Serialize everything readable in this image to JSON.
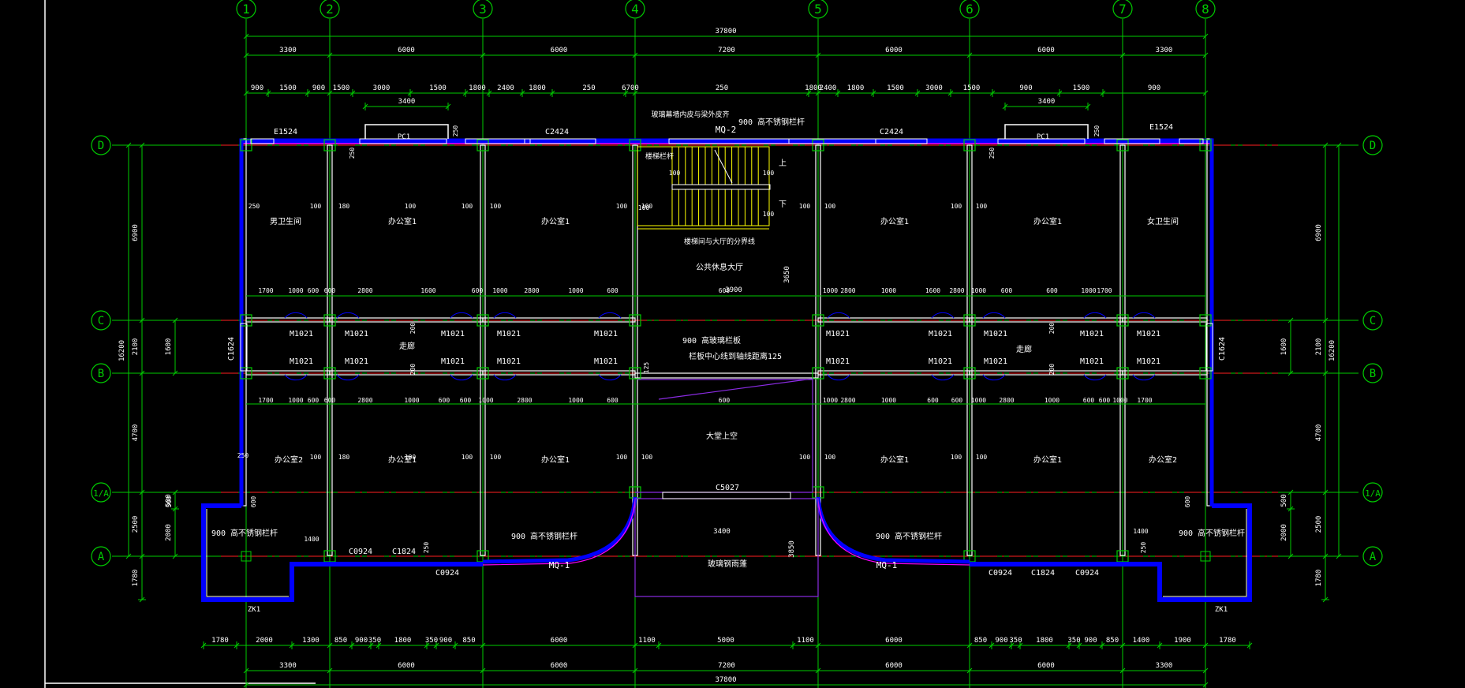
{
  "colors": {
    "background": "#000000",
    "grid_line": "#00cc00",
    "axis_dash": "#ff2020",
    "wall": "#ffffff",
    "wall_fill": "#0000ff",
    "window": "#ff00ff",
    "stair": "#ffff00",
    "text": "#ffffff",
    "dim_text": "#ffffff",
    "opening": "#8a2be2"
  },
  "axes": {
    "vertical": [
      "1",
      "2",
      "3",
      "4",
      "5",
      "6",
      "7",
      "8"
    ],
    "horizontal_left": [
      "D",
      "C",
      "B",
      "1/A",
      "A"
    ],
    "horizontal_right": [
      "D",
      "C",
      "B",
      "1/A",
      "A"
    ]
  },
  "dimensions": {
    "top_total": "37800",
    "top_bays": [
      "3300",
      "6000",
      "6000",
      "7200",
      "6000",
      "6000",
      "3300"
    ],
    "top_detail": [
      "900",
      "1500",
      "900",
      "1500",
      "3000",
      "1500",
      "1800",
      "2400",
      "1800",
      "250",
      "6700",
      "250",
      "1800",
      "2400",
      "1800",
      "1500",
      "3000",
      "1500",
      "900",
      "1500",
      "900"
    ],
    "top_pc_left": "3400",
    "top_pc_right": "3400",
    "bottom_bays": [
      "3300",
      "6000",
      "6000",
      "7200",
      "6000",
      "6000",
      "3300"
    ],
    "bottom_total": "37800",
    "bottom_detail": [
      "1780",
      "2000",
      "1300",
      "850",
      "900",
      "350",
      "1800",
      "350",
      "900",
      "850",
      "6000",
      "1100",
      "5000",
      "1100",
      "6000",
      "850",
      "900",
      "350",
      "1800",
      "350",
      "900",
      "850",
      "1400",
      "1900",
      "1780"
    ],
    "left_outer": [
      "6900",
      "2100",
      "4700",
      "2500",
      "1780"
    ],
    "left_total": "16200",
    "left_inner": [
      "250",
      "1600",
      "250",
      "500",
      "2000"
    ],
    "right_outer": [
      "6900",
      "2100",
      "4700",
      "2500",
      "1780"
    ],
    "right_total": "16200",
    "right_inner": [
      "250",
      "1600",
      "250",
      "500",
      "2000"
    ],
    "corridor_upper": [
      "1700",
      "1000",
      "600",
      "600",
      "2800",
      "1600",
      "600",
      "1000",
      "2800",
      "1000",
      "600",
      "600",
      "1000",
      "2800",
      "1000",
      "1600",
      "2800",
      "1000",
      "600",
      "600",
      "1000",
      "1700"
    ],
    "corridor_lower": [
      "1700",
      "1000",
      "600",
      "600",
      "2800",
      "1000",
      "600",
      "600",
      "1000",
      "2800",
      "1000",
      "600",
      "600",
      "1000",
      "2800",
      "1000",
      "600",
      "600",
      "1000",
      "2800",
      "1000",
      "600",
      "600",
      "1000",
      "1700"
    ],
    "wall_offsets": [
      "100",
      "100",
      "100",
      "100",
      "100",
      "100",
      "100",
      "100",
      "100",
      "100",
      "100",
      "100",
      "100",
      "100",
      "100",
      "100",
      "100",
      "100",
      "100",
      "100"
    ]
  },
  "labels": {
    "windows": {
      "e1524_left": "E1524",
      "pc1_left": "PC1",
      "c2424_left": "C2424",
      "mq2": "MQ-2",
      "c2424_right": "C2424",
      "pc1_right": "PC1",
      "e1524_right": "E1524",
      "c1624_left": "C1624",
      "c1624_right": "C1624",
      "c0924_a": "C0924",
      "c1824_a": "C1824",
      "c0924_b": "C0924",
      "mq1_left": "MQ-1",
      "c5027": "C5027",
      "mq1_right": "MQ-1",
      "c0924_c": "C0924",
      "c1824_b": "C1824",
      "c0924_d": "C0924"
    },
    "doors": [
      "M1021",
      "M1021",
      "M1021",
      "M1021",
      "M1021",
      "M1021",
      "M1021",
      "M1021",
      "M1021",
      "M1021",
      "M1021",
      "M1021",
      "M1021",
      "M1021",
      "M1021",
      "M1021",
      "M1021",
      "M1021",
      "M1021",
      "M1021"
    ],
    "rooms": {
      "r1": "男卫生间",
      "r2": "办公室1",
      "r3": "办公室1",
      "r4": "办公室1",
      "r5": "办公室1",
      "r6": "女卫生间",
      "hall": "公共休息大厅",
      "corridor_left": "走廊",
      "corridor_right": "走廊",
      "b1": "办公室2",
      "b2": "办公室1",
      "b3": "办公室1",
      "void": "大堂上空",
      "b4": "办公室1",
      "b5": "办公室1",
      "b6": "办公室2",
      "canopy": "玻璃钢雨蓬"
    },
    "notes": {
      "top_curtain": "玻璃幕墙内皮与梁外皮齐",
      "rail_top": "900 高不锈钢栏杆",
      "stair_rail": "楼梯栏杆",
      "stair_edge": "楼梯间与大厅的分界线",
      "up1": "上",
      "up2": "下",
      "rail_hall": "900 高玻璃栏板",
      "rail_hall2": "栏板中心线到轴线距离125",
      "rail_l": "900 高不锈钢栏杆",
      "rail_mid_l": "900 高不锈钢栏杆",
      "rail_mid_r": "900 高不锈钢栏杆",
      "rail_r": "900 高不锈钢栏杆",
      "zk_left": "ZK1",
      "zk_right": "ZK1"
    },
    "misc_dims": {
      "hall_3650": "3650",
      "hall_3900": "3900",
      "stair_100a": "100",
      "stair_100b": "100",
      "stair_100c": "100",
      "stair_100d": "100",
      "d250a": "250",
      "d250b": "250",
      "d250c": "250",
      "d250d": "250",
      "d250e": "250",
      "d250f": "250",
      "d600a": "600",
      "d600b": "600",
      "d500a": "500",
      "d1400a": "1400",
      "d1400b": "1400",
      "d3400": "3400",
      "d3850": "3850",
      "d250g": "250",
      "d250h": "250",
      "d125": "125",
      "d200a": "200",
      "d200b": "200",
      "d200c": "200",
      "d200d": "200",
      "d180a": "180",
      "d180b": "180"
    }
  }
}
